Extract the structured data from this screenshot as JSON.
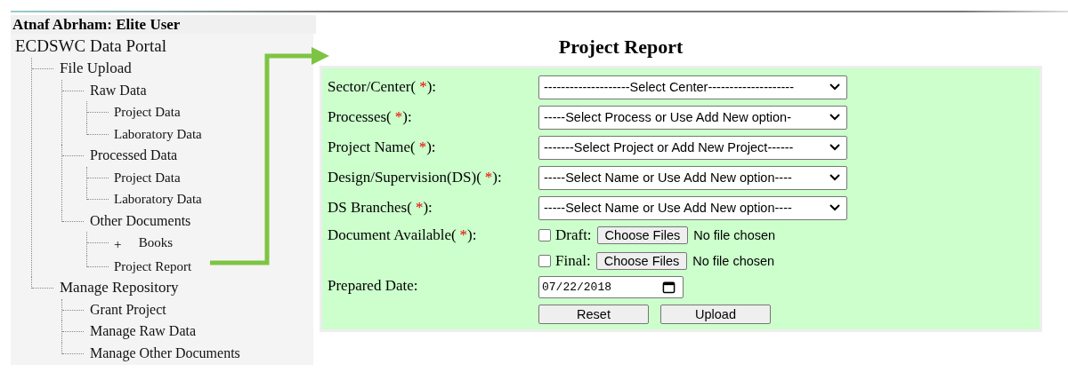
{
  "user_header": "Atnaf Abrham: Elite User",
  "tree": {
    "label": "ECDSWC Data Portal",
    "children": [
      {
        "label": "File Upload",
        "children": [
          {
            "label": "Raw Data",
            "children": [
              {
                "label": "Project Data"
              },
              {
                "label": "Laboratory Data"
              }
            ]
          },
          {
            "label": "Processed Data",
            "children": [
              {
                "label": "Project Data"
              },
              {
                "label": "Laboratory Data"
              }
            ]
          },
          {
            "label": "Other Documents",
            "children": [
              {
                "label": "Books",
                "expander": "+"
              },
              {
                "label": "Project Report"
              }
            ]
          }
        ]
      },
      {
        "label": "Manage Repository",
        "children": [
          {
            "label": "Grant Project"
          },
          {
            "label": "Manage Raw Data"
          },
          {
            "label": "Manage Other Documents"
          }
        ]
      }
    ]
  },
  "page_title": "Project Report",
  "form": {
    "fields": [
      {
        "kind": "select",
        "label": "Sector/Center(",
        "required": "*",
        "label_end": "):",
        "value": "--------------------Select Center--------------------"
      },
      {
        "kind": "select",
        "label": "Processes(",
        "required": "*",
        "label_end": "):",
        "value": "-----Select Process or Use Add New option-"
      },
      {
        "kind": "select",
        "label": "Project Name(",
        "required": "*",
        "label_end": "):",
        "value": "-------Select Project or Add New Project------"
      },
      {
        "kind": "select",
        "label": "Design/Supervision(DS)(",
        "required": "*",
        "label_end": "):",
        "value": "-----Select Name or Use Add New option----"
      },
      {
        "kind": "select",
        "label": "DS Branches(",
        "required": "*",
        "label_end": "):",
        "value": "-----Select Name or Use Add New option----"
      },
      {
        "kind": "files",
        "label": "Document Available(",
        "required": "*",
        "label_end": "):",
        "files": [
          {
            "label": "Draft:",
            "checked": false,
            "button": "Choose Files",
            "status": "No file chosen"
          },
          {
            "label": "Final:",
            "checked": false,
            "button": "Choose Files",
            "status": "No file chosen"
          }
        ]
      },
      {
        "kind": "date",
        "label": "Prepared Date:",
        "value": "07/22/2018"
      }
    ],
    "buttons": [
      "Reset",
      "Upload"
    ]
  }
}
